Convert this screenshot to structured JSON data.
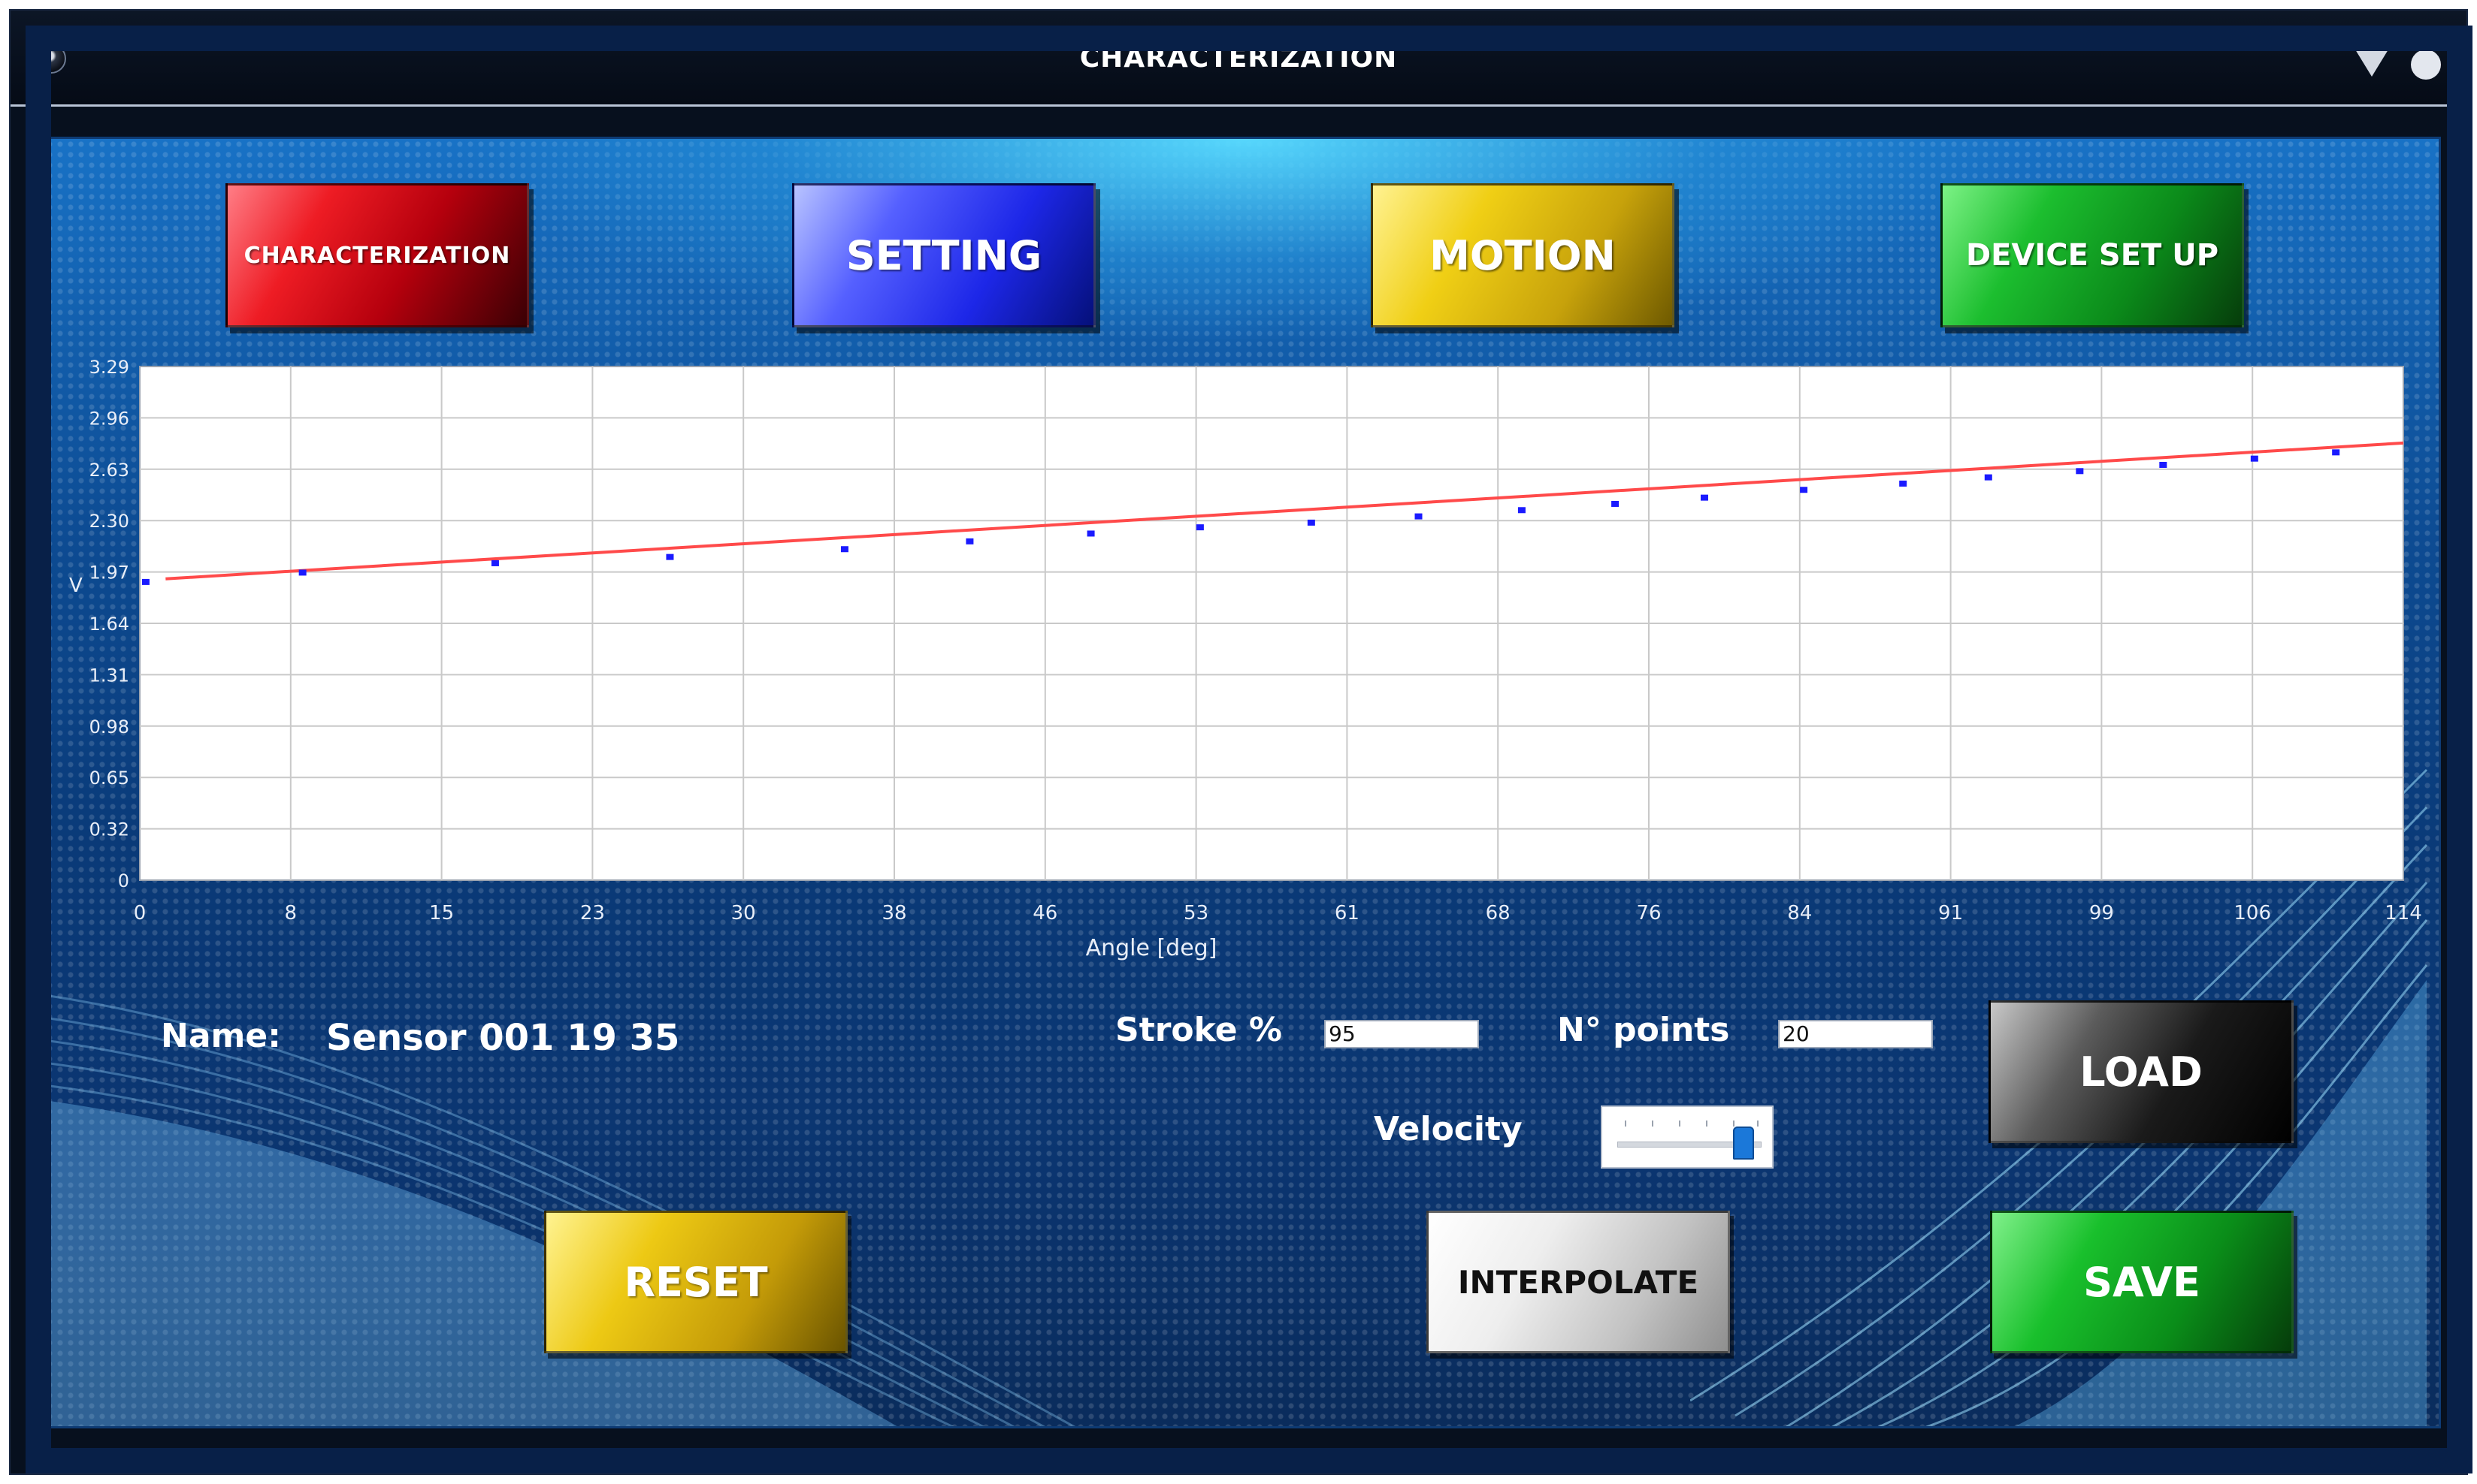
{
  "window": {
    "title": "CHARACTERIZATION"
  },
  "nav": {
    "characterization": "CHARACTERIZATION",
    "setting": "SETTING",
    "motion": "MOTION",
    "device_setup": "DEVICE SET UP"
  },
  "colors": {
    "fit_line": "#ff4a4a",
    "points": "#1a1aff",
    "grid": "#c9c9c9"
  },
  "chart_data": {
    "type": "scatter",
    "xlabel": "Angle [deg]",
    "ylabel": "V",
    "xlim": [
      0,
      114
    ],
    "ylim": [
      0,
      3.29
    ],
    "xticks": [
      "0",
      "8",
      "15",
      "23",
      "30",
      "38",
      "46",
      "53",
      "61",
      "68",
      "76",
      "84",
      "91",
      "99",
      "106",
      "114"
    ],
    "yticks": [
      "0",
      "0.32",
      "0.65",
      "0.98",
      "1.31",
      "1.64",
      "1.97",
      "2.30",
      "2.63",
      "2.96",
      "3.29"
    ],
    "grid": true,
    "series": [
      {
        "kind": "points",
        "x": [
          0.3,
          8.2,
          17.9,
          26.7,
          35.5,
          41.8,
          47.9,
          53.4,
          59.0,
          64.4,
          69.6,
          74.3,
          78.8,
          83.8,
          88.8,
          93.1,
          97.7,
          101.9,
          106.5,
          110.6
        ],
        "y": [
          1.91,
          1.97,
          2.03,
          2.07,
          2.12,
          2.17,
          2.22,
          2.26,
          2.29,
          2.33,
          2.37,
          2.41,
          2.45,
          2.5,
          2.54,
          2.58,
          2.62,
          2.66,
          2.7,
          2.74
        ]
      },
      {
        "kind": "line",
        "x": [
          1.3,
          114
        ],
        "y": [
          1.93,
          2.8
        ]
      }
    ]
  },
  "form": {
    "name_label": "Name:",
    "name_value": "Sensor 001 19 35",
    "stroke_label": "Stroke %",
    "stroke_value": "95",
    "points_label": "N° points",
    "points_value": "20",
    "velocity_label": "Velocity",
    "velocity_level": 0.95
  },
  "actions": {
    "load": "LOAD",
    "reset": "RESET",
    "interpolate": "INTERPOLATE",
    "save": "SAVE"
  }
}
